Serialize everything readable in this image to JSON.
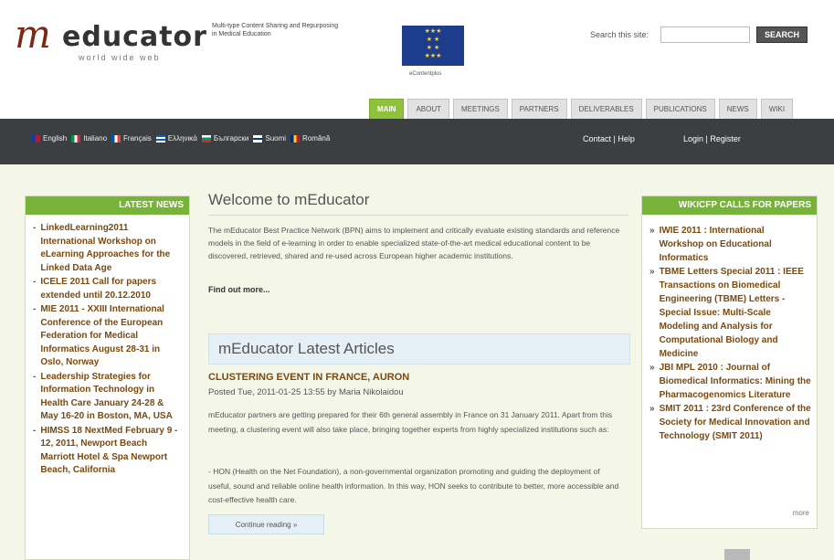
{
  "header": {
    "logo_m": "m",
    "logo_word": "educator",
    "logo_sub": "world wide web",
    "tagline": "Multi-type Content Sharing and Repurposing in Medical Education",
    "eu_caption": "eContentplus",
    "search_label": "Search this site:",
    "search_value": "",
    "search_button": "SEARCH"
  },
  "tabs": [
    "MAIN",
    "ABOUT",
    "MEETINGS",
    "PARTNERS",
    "DELIVERABLES",
    "PUBLICATIONS",
    "NEWS",
    "WIKI"
  ],
  "navbar": {
    "languages": [
      {
        "label": "English",
        "colors": [
          "#1e3c8c",
          "#c8102e"
        ]
      },
      {
        "label": "Italiano",
        "colors": [
          "#009246",
          "#ce2b37"
        ]
      },
      {
        "label": "Français",
        "colors": [
          "#0055a4",
          "#ef4135"
        ]
      },
      {
        "label": "Ελληνικά",
        "colors": [
          "#0d5eaf",
          "#ffffff"
        ]
      },
      {
        "label": "Български",
        "colors": [
          "#00966e",
          "#d62612"
        ]
      },
      {
        "label": "Suomi",
        "colors": [
          "#ffffff",
          "#003580"
        ]
      },
      {
        "label": "Română",
        "colors": [
          "#002b7f",
          "#fcd116"
        ]
      }
    ],
    "contact_help": "Contact | Help",
    "login_register": "Login | Register"
  },
  "latest_news": {
    "title": "LATEST NEWS",
    "items": [
      "LinkedLearning2011 International Workshop on eLearning Approaches for the Linked Data Age",
      "ICELE 2011 Call for papers extended until 20.12.2010",
      "MIE 2011 - XXIII International Conference of the European Federation for Medical Informatics August 28-31 in Oslo, Norway",
      "Leadership Strategies for Information Technology in Health Care January 24-28 & May 16-20 in Boston, MA, USA",
      "HIMSS 18 NextMed February 9 - 12, 2011, Newport Beach Marriott Hotel & Spa Newport Beach, California"
    ]
  },
  "main": {
    "welcome_title": "Welcome to mEducator",
    "welcome_text": "The mEducator Best Practice Network (BPN) aims to implement and critically evaluate existing standards and reference models in the field of e-learning in order to enable specialized state-of-the-art medical educational content to be discovered, retrieved, shared and re-used across European higher academic institutions.",
    "find_more": "Find out more...",
    "articles_title": "mEducator Latest Articles",
    "article_title": "CLUSTERING EVENT IN FRANCE, AURON",
    "article_meta": "Posted Tue, 2011-01-25 13:55 by Maria Nikolaidou",
    "article_p1": "mEducator partners are getting prepared for their 6th general assembly in France on 31 January 2011. Apart from this meeting, a clustering event will also take place, bringing together experts from highly specialized institutions such as:",
    "article_p2": "- HON (Health on the Net Foundation), a non-governmental organization promoting and guiding the deployment of useful, sound and reliable online health information. In this way, HON seeks to contribute to better, more accessible and cost-effective health care.",
    "continue_reading": "Continue reading  »"
  },
  "wikicfp": {
    "title": "WIKICFP CALLS FOR PAPERS",
    "items": [
      "IWIE 2011 : International Workshop on Educational Informatics",
      "TBME Letters Special 2011 : IEEE Transactions on Biomedical Engineering (TBME) Letters - Special Issue: Multi-Scale Modeling and Analysis for Computational Biology and Medicine",
      "JBI MPL 2010 : Journal of Biomedical Informatics: Mining the Pharmacogenomics Literature",
      "SMIT 2011 : 23rd Conference of the Society for Medical Innovation and Technology (SMIT 2011)"
    ],
    "more": "more"
  }
}
